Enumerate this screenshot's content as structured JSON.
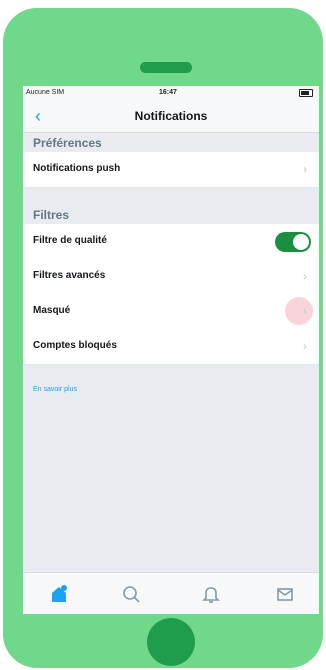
{
  "status_bar": {
    "carrier": "Aucune SIM",
    "time": "16:47"
  },
  "nav": {
    "back_icon": "chevron-left-icon",
    "title": "Notifications"
  },
  "sections": {
    "preferences": {
      "header": "Préférences",
      "rows": [
        {
          "label": "Notifications push"
        }
      ]
    },
    "filters": {
      "header": "Filtres",
      "rows": [
        {
          "label": "Filtre de qualité",
          "toggle_on": true
        },
        {
          "label": "Filtres avancés"
        },
        {
          "label": "Masqué"
        },
        {
          "label": "Comptes bloqués"
        }
      ]
    }
  },
  "learn_more": "En savoir plus",
  "tab_bar": {
    "tabs": [
      "home-icon",
      "search-icon",
      "bell-icon",
      "mail-icon"
    ],
    "active_color": "#1da1f2",
    "inactive_color": "#8899a6"
  },
  "colors": {
    "phone": "#6fd88a",
    "phone_buttons": "#1f9d4c",
    "toggle_on": "#1a8f3f",
    "accent": "#1da1f2"
  }
}
